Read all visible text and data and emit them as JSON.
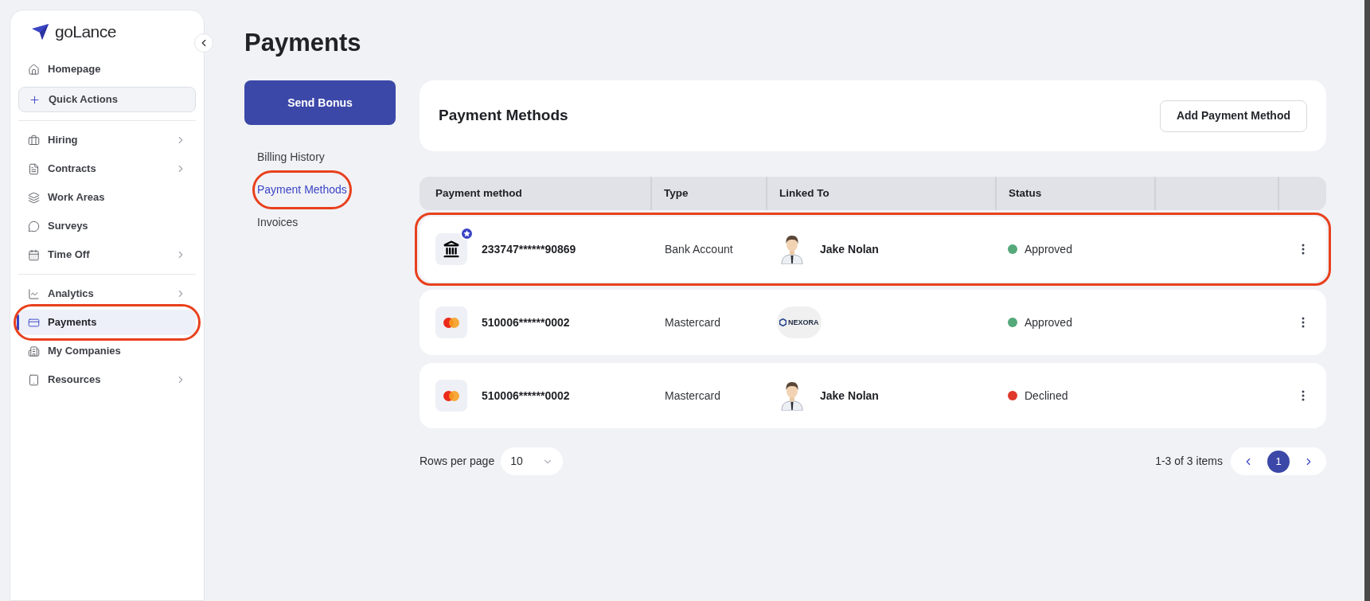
{
  "sidebar": {
    "logo": "goLance",
    "groups": [
      [
        {
          "label": "Homepage",
          "kind": "link",
          "has_children": false,
          "selected": false,
          "annotated": false
        },
        {
          "label": "Quick Actions",
          "kind": "action",
          "has_children": false,
          "selected": false,
          "annotated": false
        }
      ],
      [
        {
          "label": "Hiring",
          "kind": "link",
          "has_children": true,
          "selected": false,
          "annotated": false
        },
        {
          "label": "Contracts",
          "kind": "link",
          "has_children": true,
          "selected": false,
          "annotated": false
        },
        {
          "label": "Work Areas",
          "kind": "link",
          "has_children": false,
          "selected": false,
          "annotated": false
        },
        {
          "label": "Surveys",
          "kind": "link",
          "has_children": false,
          "selected": false,
          "annotated": false
        },
        {
          "label": "Time Off",
          "kind": "link",
          "has_children": true,
          "selected": false,
          "annotated": false
        }
      ],
      [
        {
          "label": "Analytics",
          "kind": "link",
          "has_children": true,
          "selected": false,
          "annotated": false
        },
        {
          "label": "Payments",
          "kind": "link",
          "has_children": false,
          "selected": true,
          "annotated": true
        },
        {
          "label": "My Companies",
          "kind": "link",
          "has_children": false,
          "selected": false,
          "annotated": false
        },
        {
          "label": "Resources",
          "kind": "link",
          "has_children": true,
          "selected": false,
          "annotated": false
        }
      ]
    ]
  },
  "page_title": "Payments",
  "send_bonus": "Send Bonus",
  "subnav": [
    {
      "label": "Billing History",
      "selected": false,
      "annotated": false
    },
    {
      "label": "Payment Methods",
      "selected": true,
      "annotated": true
    },
    {
      "label": "Invoices",
      "selected": false,
      "annotated": false
    }
  ],
  "card": {
    "title": "Payment Methods",
    "button": "Add Payment Method"
  },
  "table": {
    "columns": [
      "Payment method",
      "Type",
      "Linked To",
      "Status"
    ],
    "rows": [
      {
        "kind": "bank",
        "preferred": true,
        "number": "233747******90869",
        "type": "Bank Account",
        "linked": {
          "kind": "person",
          "name": "Jake Nolan"
        },
        "status": "Approved",
        "color": "#55a97b",
        "annotated": true
      },
      {
        "kind": "mastercard",
        "preferred": false,
        "number": "510006******0002",
        "type": "Mastercard",
        "linked": {
          "kind": "company",
          "logo_text": "NEXORA"
        },
        "status": "Approved",
        "color": "#55a97b",
        "annotated": false
      },
      {
        "kind": "mastercard",
        "preferred": false,
        "number": "510006******0002",
        "type": "Mastercard",
        "linked": {
          "kind": "person",
          "name": "Jake Nolan"
        },
        "status": "Declined",
        "color": "#e0382b",
        "annotated": false
      }
    ]
  },
  "pagination": {
    "rows_per_page_label": "Rows per page",
    "rows_per_page": "10",
    "range": "1-3 of 3 items",
    "pages": [
      {
        "label": "1",
        "selected": true
      }
    ]
  }
}
